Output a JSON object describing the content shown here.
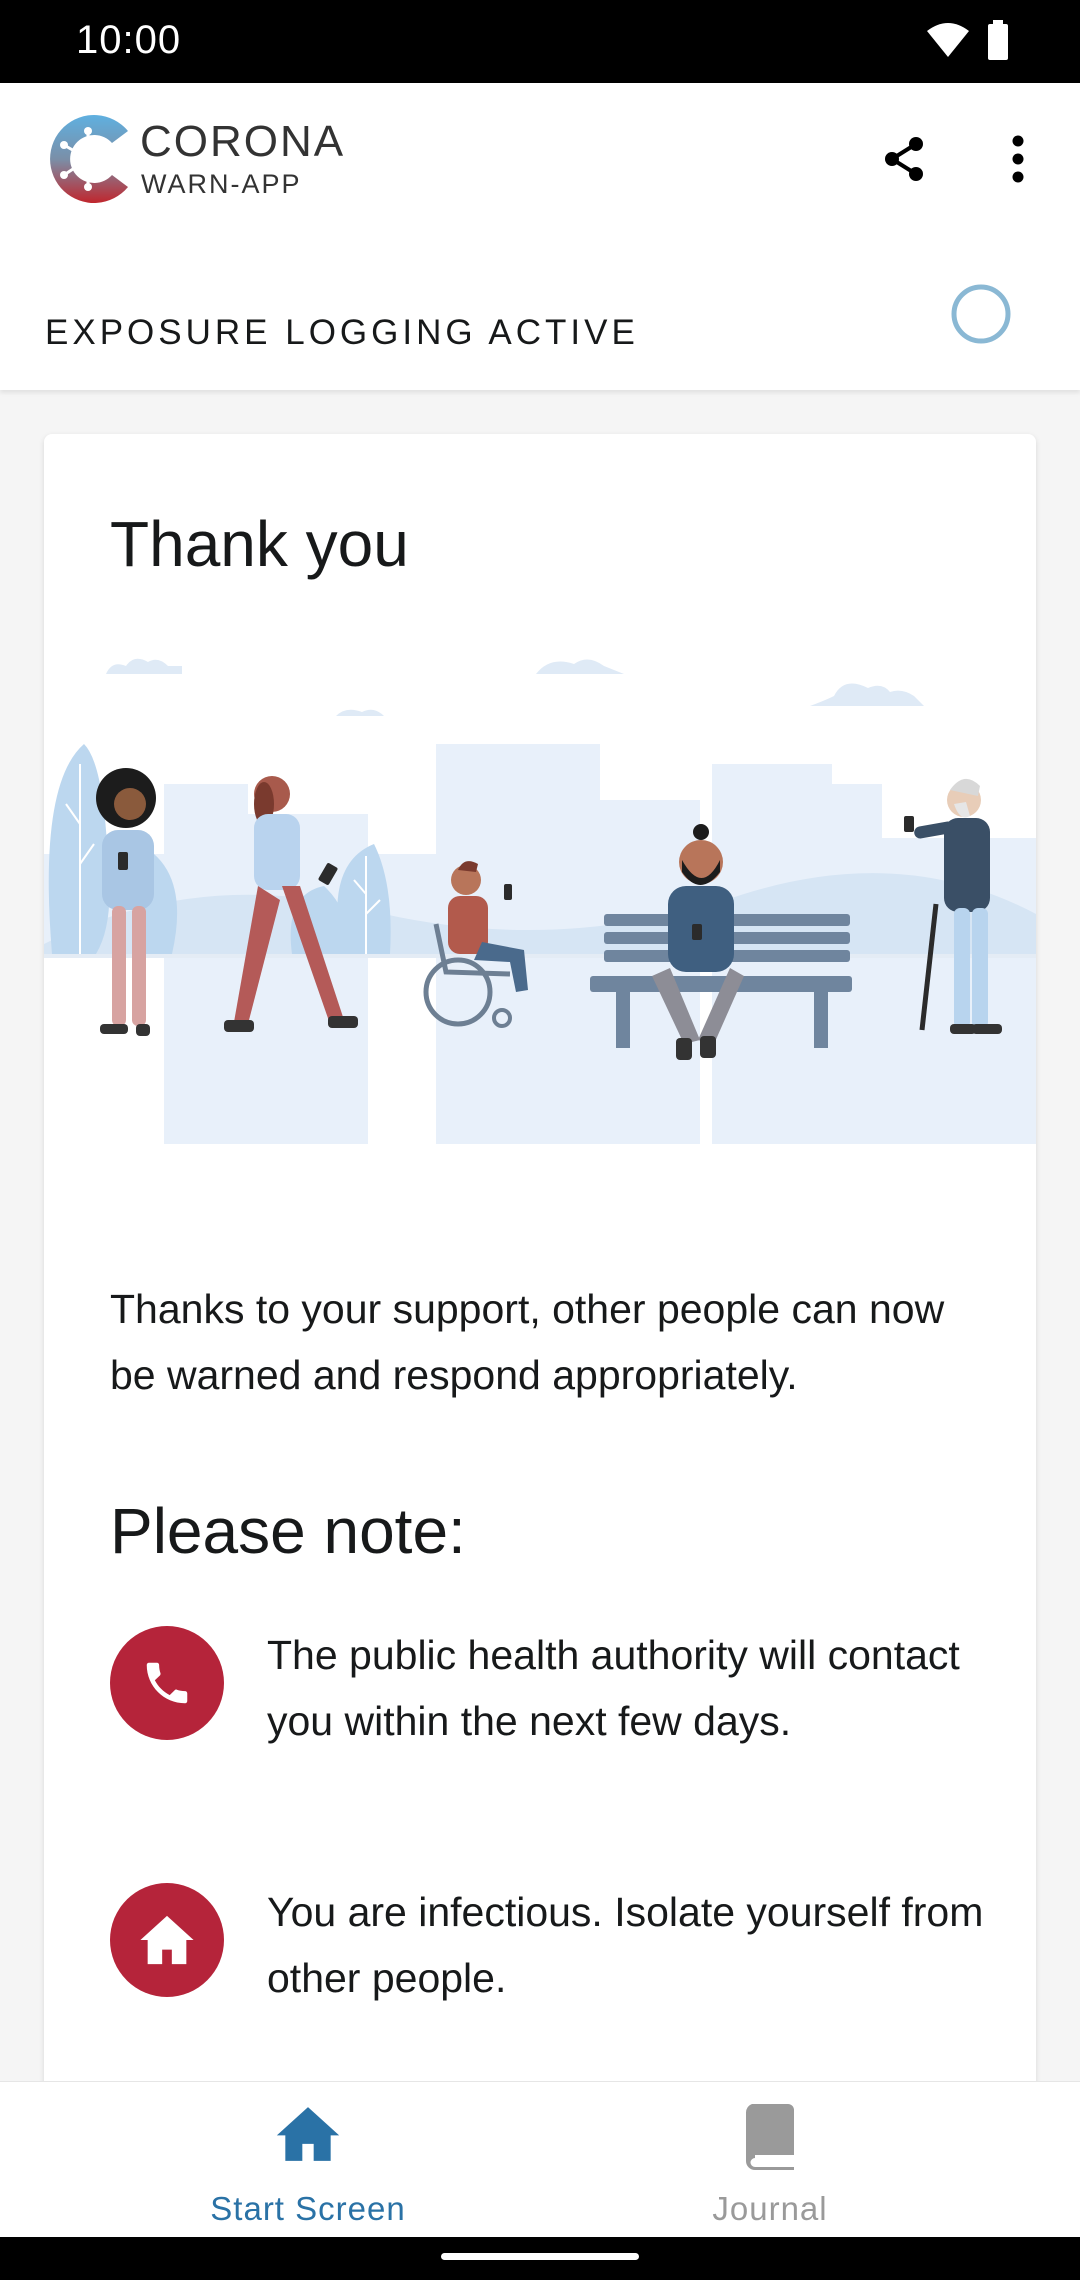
{
  "status_bar": {
    "time": "10:00"
  },
  "brand": {
    "title": "CORONA",
    "subtitle": "WARN-APP"
  },
  "header": {
    "exposure_status": "EXPOSURE LOGGING ACTIVE"
  },
  "card": {
    "title": "Thank you",
    "body": "Thanks to your support, other people can now be warned and respond appropriately.",
    "note_heading": "Please note:",
    "notes": [
      {
        "icon": "phone-icon",
        "text": "The public health authority will contact you within the next few days."
      },
      {
        "icon": "home-icon",
        "text": "You are infectious. Isolate yourself from other people."
      }
    ]
  },
  "bottom_nav": {
    "items": [
      {
        "label": "Start Screen",
        "icon": "home-icon",
        "active": true
      },
      {
        "label": "Journal",
        "icon": "journal-book-icon",
        "active": false
      }
    ]
  },
  "colors": {
    "accent_red": "#b5243a",
    "nav_active": "#2a72a6",
    "nav_inactive": "#9a9a9a",
    "ring": "#8ab8d4"
  }
}
